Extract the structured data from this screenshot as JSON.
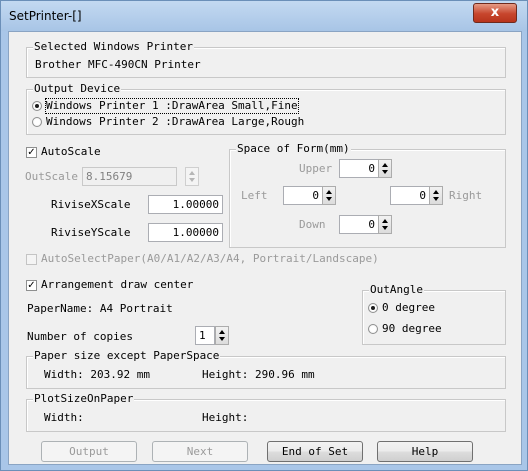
{
  "window": {
    "title": "SetPrinter-[]",
    "close_label": "x"
  },
  "selected_printer": {
    "legend": "Selected Windows Printer",
    "name": "Brother MFC-490CN Printer"
  },
  "output_device": {
    "legend": "Output Device",
    "option1": "Windows Printer 1 :DrawArea Small,Fine",
    "option2": "Windows Printer 2 :DrawArea Large,Rough",
    "selected": 1
  },
  "autoscale": {
    "label": "AutoScale",
    "checked": true,
    "outscale_label": "OutScale",
    "outscale_value": "8.15679",
    "rivisex_label": "RiviseXScale",
    "rivisex_value": "1.00000",
    "rivisey_label": "RiviseYScale",
    "rivisey_value": "1.00000"
  },
  "space_of_form": {
    "legend": "Space of Form(mm)",
    "upper_label": "Upper",
    "upper_value": "0",
    "left_label": "Left",
    "left_value": "0",
    "right_label": "Right",
    "right_value": "0",
    "down_label": "Down",
    "down_value": "0"
  },
  "auto_select_paper": {
    "label": "AutoSelectPaper(A0/A1/A2/A3/A4, Portrait/Landscape)",
    "checked": false
  },
  "arrangement": {
    "label": "Arrangement draw center",
    "checked": true
  },
  "paper_name": "PaperName: A4 Portrait",
  "copies": {
    "label": "Number of copies",
    "value": "1"
  },
  "out_angle": {
    "legend": "OutAngle",
    "option1": "0 degree",
    "option2": "90 degree",
    "selected": 1
  },
  "paper_size": {
    "legend": "Paper size except PaperSpace",
    "width": "Width: 203.92 mm",
    "height": "Height: 290.96 mm"
  },
  "plot_size": {
    "legend": "PlotSizeOnPaper",
    "width": "Width:",
    "height": "Height:"
  },
  "buttons": {
    "output": "Output",
    "next": "Next",
    "end_of_set": "End of Set",
    "help": "Help"
  }
}
